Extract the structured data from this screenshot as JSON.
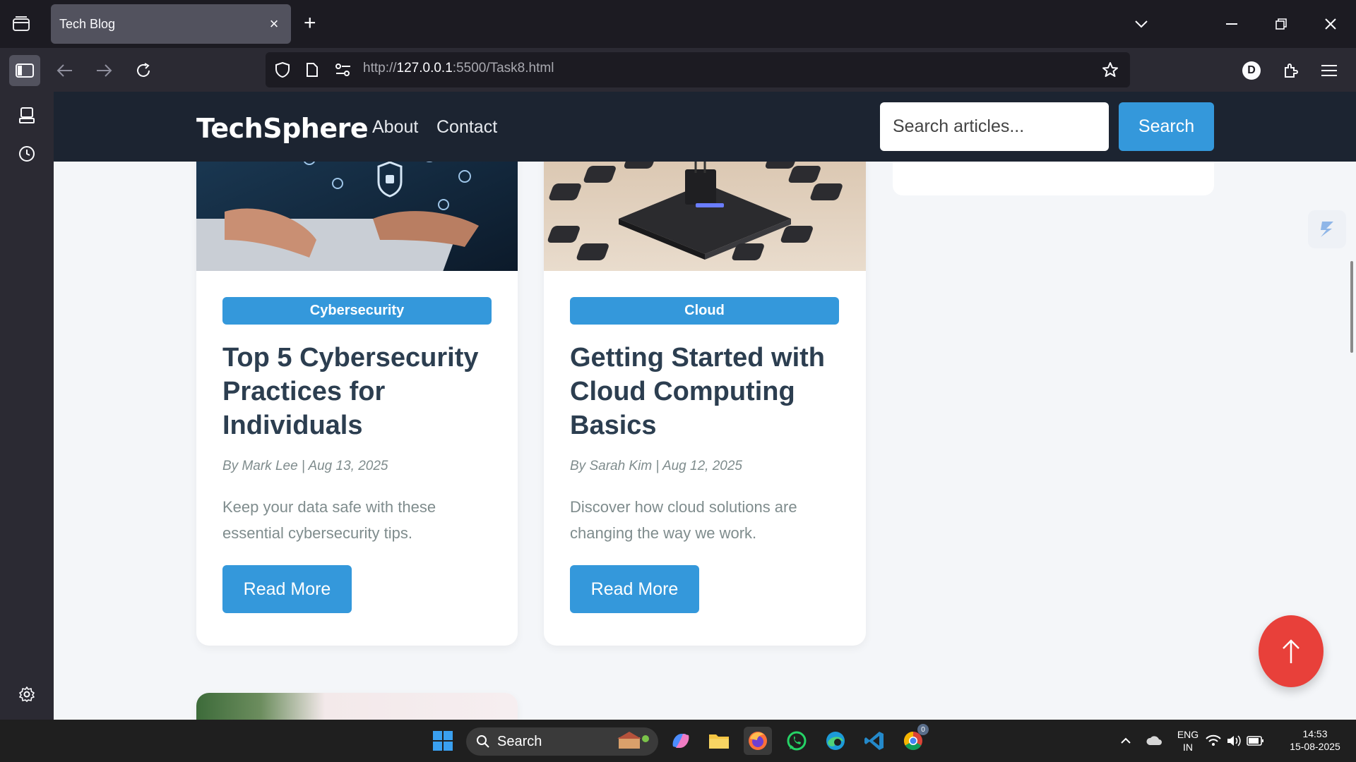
{
  "browser": {
    "tab_title": "Tech Blog",
    "url_prefix": "http://",
    "url_host": "127.0.0.1",
    "url_rest": ":5500/Task8.html",
    "profile_initial": "D"
  },
  "site": {
    "logo": "TechSphere",
    "nav": [
      "About",
      "Contact"
    ],
    "search_placeholder": "Search articles...",
    "search_button": "Search"
  },
  "posts": [
    {
      "tag": "Cybersecurity",
      "title": "Top 5 Cybersecurity Practices for Individuals",
      "meta": "By Mark Lee | Aug 13, 2025",
      "excerpt": "Keep your data safe with these essential cybersecurity tips.",
      "button": "Read More"
    },
    {
      "tag": "Cloud",
      "title": "Getting Started with Cloud Computing Basics",
      "meta": "By Sarah Kim | Aug 12, 2025",
      "excerpt": "Discover how cloud solutions are changing the way we work.",
      "button": "Read More"
    }
  ],
  "taskbar": {
    "search_label": "Search",
    "lang_top": "ENG",
    "lang_bottom": "IN",
    "time": "14:53",
    "date": "15-08-2025",
    "chrome_badge": "0"
  },
  "colors": {
    "accent": "#3498db",
    "scroll_top": "#e8403a",
    "header_bg": "#1c2431"
  }
}
